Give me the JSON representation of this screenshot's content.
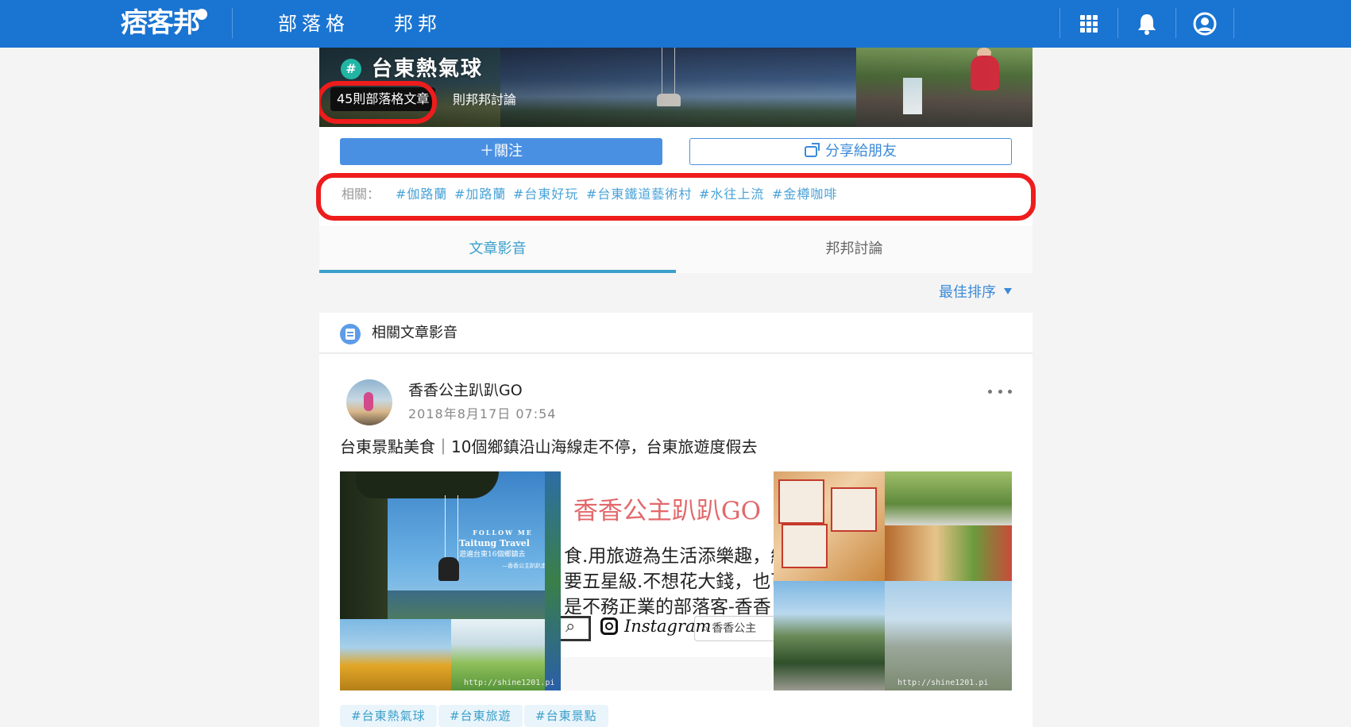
{
  "header": {
    "logo": "痞客邦",
    "nav": [
      "部落格",
      "邦邦"
    ],
    "icons": [
      "apps-icon",
      "bell-icon",
      "user-icon"
    ],
    "brand_color": "#1a74d2"
  },
  "hero": {
    "hash_symbol": "#",
    "title": "台東熱氣球",
    "blog_count": "45則部落格文章",
    "discussion_count": "則邦邦討論"
  },
  "actions": {
    "follow_label": "＋關注",
    "share_label": "分享給朋友"
  },
  "related": {
    "label": "相關：",
    "tags": [
      "#伽路蘭",
      "#加路蘭",
      "#台東好玩",
      "#台東鐵道藝術村",
      "#水往上流",
      "#金樽咖啡"
    ]
  },
  "tabs": [
    "文章影音",
    "邦邦討論"
  ],
  "active_tab": "文章影音",
  "sort": {
    "label": "最佳排序"
  },
  "section": {
    "title": "相關文章影音"
  },
  "post": {
    "author": "香香公主趴趴GO",
    "date": "2018年8月17日 07:54",
    "title": "台東景點美食｜10個鄉鎮沿山海線走不停，台東旅遊度假去",
    "image_texts": {
      "img1_caption_1": "FOLLOW ME",
      "img1_caption_2": "Taitung Travel",
      "img1_caption_3": "遊遍台東16個鄉鎮去",
      "img1_caption_4": "—香香公主趴趴走",
      "watermark": "http://shine1201.pi",
      "img2_name": "香香公主趴趴GO",
      "img2_line1": "食.用旅遊為生活添樂趣，繼",
      "img2_line2": "要五星級.不想花大錢，也可",
      "img2_line3": "是不務正業的部落客-香香",
      "img2_instagram": "Instagram",
      "img2_search": "香香公主",
      "img3_watermark": "http://shine1201.pi"
    },
    "tags": [
      "#台東熱氣球",
      "#台東旅遊",
      "#台東景點"
    ]
  }
}
